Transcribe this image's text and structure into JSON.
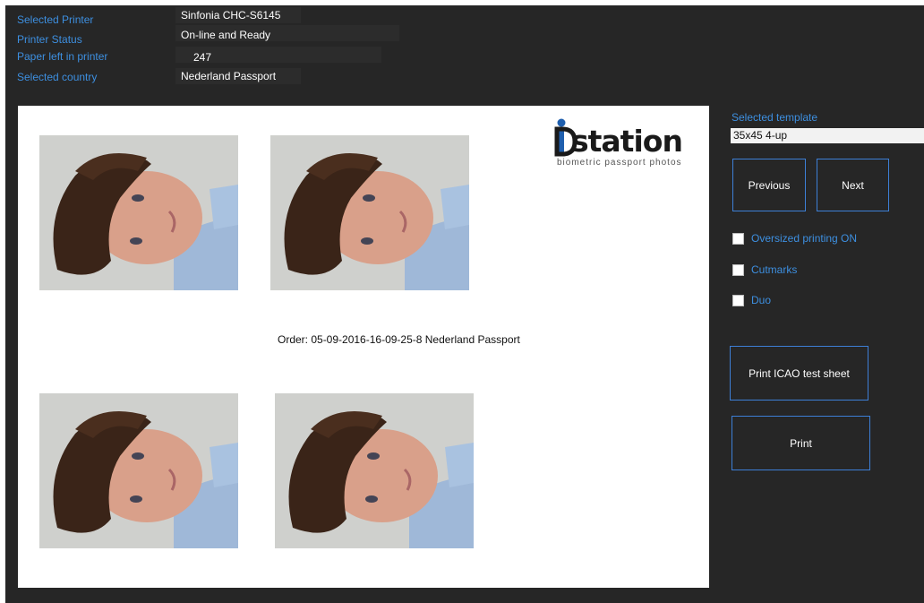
{
  "printer_info": {
    "selected_printer_label": "Selected Printer",
    "selected_printer_value": "Sinfonia CHC-S6145",
    "printer_status_label": "Printer Status",
    "printer_status_value": "On-line and Ready",
    "paper_left_label": "Paper left in printer",
    "paper_left_value": "247",
    "country_label": "Selected country",
    "country_value": "Nederland Passport"
  },
  "preview": {
    "logo_text": "station",
    "logo_subtitle": "biometric passport photos",
    "order_text": "Order: 05-09-2016-16-09-25-8 Nederland Passport",
    "photo_count": 4
  },
  "sidebar": {
    "template_label": "Selected template",
    "template_value": "35x45 4-up",
    "previous_label": "Previous",
    "next_label": "Next",
    "oversized_label": "Oversized printing ON",
    "oversized_checked": false,
    "cutmarks_label": "Cutmarks",
    "cutmarks_checked": false,
    "duo_label": "Duo",
    "duo_checked": false,
    "icao_label": "Print ICAO test sheet",
    "print_label": "Print"
  },
  "colors": {
    "background": "#262626",
    "accent": "#3d8fe0",
    "logo_blue": "#1f5fae"
  }
}
